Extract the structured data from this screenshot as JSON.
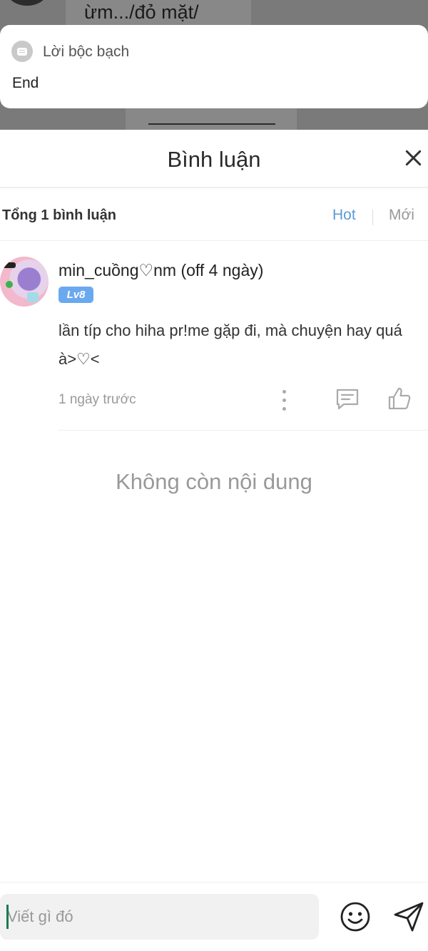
{
  "background": {
    "story_text": "ừm.../đỏ mặt/"
  },
  "note": {
    "title": "Lời bộc bạch",
    "body": "End"
  },
  "comments_panel": {
    "title": "Bình luận",
    "total_label": "Tổng 1 bình luận",
    "sort_hot": "Hot",
    "sort_new": "Mới",
    "accent_color": "#5b9bd5",
    "comments": [
      {
        "username": "min_cuồng♡nm (off 4 ngày)",
        "level": "Lv8",
        "text": "lần típ cho hiha pr!me gặp đi, mà chuyện hay quá à>♡<",
        "time": "1 ngày trước"
      }
    ],
    "empty_message": "Không còn nội dung"
  },
  "input": {
    "placeholder": "Viết gì đó"
  },
  "icons": [
    "note-icon",
    "close-icon",
    "more-icon",
    "reply-icon",
    "like-icon",
    "emoji-icon",
    "send-icon"
  ]
}
